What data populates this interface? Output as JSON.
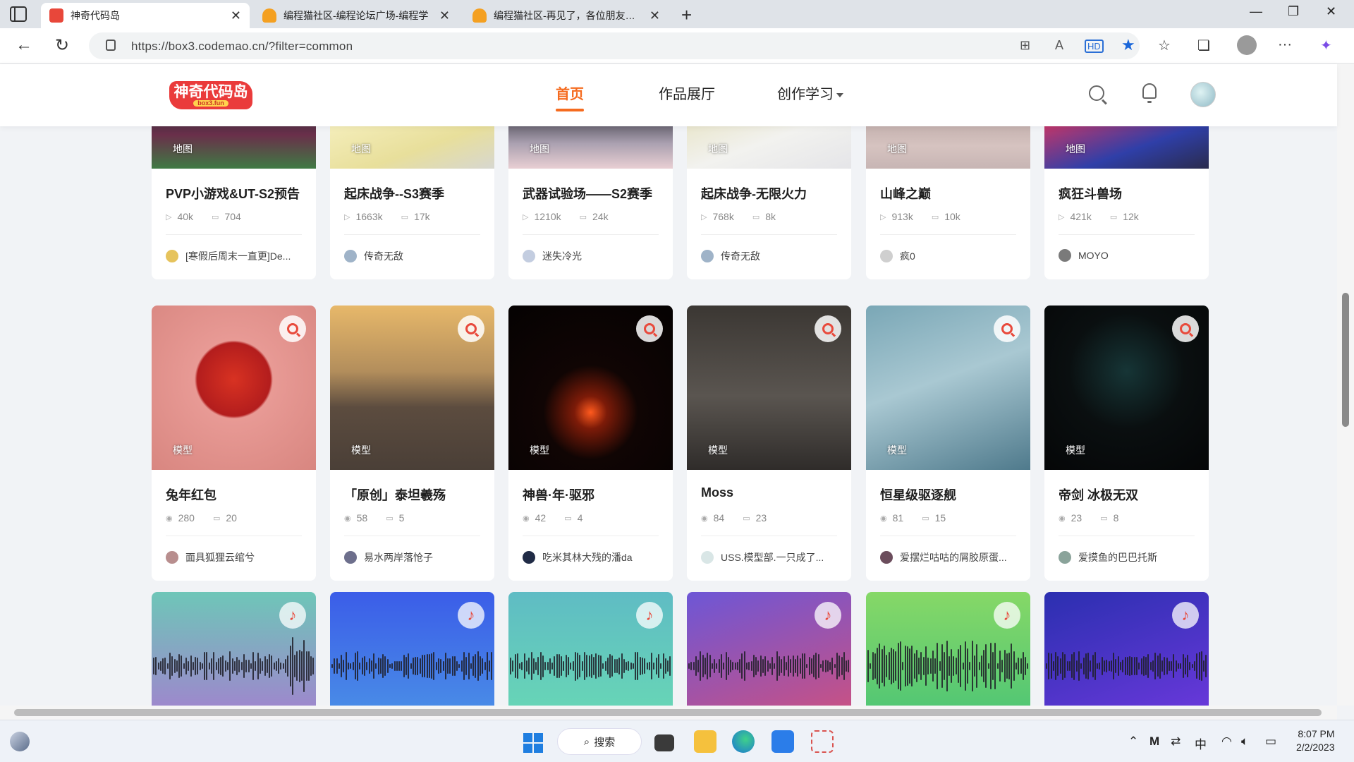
{
  "browser": {
    "tabs": [
      {
        "title": "神奇代码岛",
        "active": true
      },
      {
        "title": "编程猫社区-编程论坛广场-编程学",
        "active": false
      },
      {
        "title": "编程猫社区-再见了，各位朋友，再",
        "active": false
      }
    ],
    "url": "https://box3.codemao.cn/?filter=common"
  },
  "site": {
    "logo_text": "神奇代码岛",
    "logo_sub": "box3.fun",
    "nav": [
      "首页",
      "作品展厅",
      "创作学习"
    ]
  },
  "cards": [
    {
      "title": "PVP小游戏&UT-S2预告",
      "tag": "地图",
      "plays": "40k",
      "comments": "704",
      "author": "[寒假后周末一直更]De..."
    },
    {
      "title": "起床战争--S3赛季",
      "tag": "地图",
      "plays": "1663k",
      "comments": "17k",
      "author": "传奇无敌"
    },
    {
      "title": "武器试验场——S2赛季",
      "tag": "地图",
      "plays": "1210k",
      "comments": "24k",
      "author": "迷失冷光"
    },
    {
      "title": "起床战争-无限火力",
      "tag": "地图",
      "plays": "768k",
      "comments": "8k",
      "author": "传奇无敌"
    },
    {
      "title": "山峰之巅",
      "tag": "地图",
      "plays": "913k",
      "comments": "10k",
      "author": "疯0"
    },
    {
      "title": "疯狂斗兽场",
      "tag": "地图",
      "plays": "421k",
      "comments": "12k",
      "author": "MOYO"
    },
    {
      "title": "兔年红包",
      "tag": "模型",
      "plays": "280",
      "comments": "20",
      "author": "面具狐狸云绾兮"
    },
    {
      "title": "「原创」泰坦羲殇",
      "tag": "模型",
      "plays": "58",
      "comments": "5",
      "author": "易水两岸落怆子"
    },
    {
      "title": "神兽·年·驱邪",
      "tag": "模型",
      "plays": "42",
      "comments": "4",
      "author": "吃米其林大残的潘da"
    },
    {
      "title": "Moss",
      "tag": "模型",
      "plays": "84",
      "comments": "23",
      "author": "USS.模型部.一只成了..."
    },
    {
      "title": "恒星级驱逐舰",
      "tag": "模型",
      "plays": "81",
      "comments": "15",
      "author": "爱摆烂咕咕的屑胶原蛋..."
    },
    {
      "title": "帝剑 冰极无双",
      "tag": "模型",
      "plays": "23",
      "comments": "8",
      "author": "爱摸鱼的巴巴托斯"
    }
  ],
  "taskbar": {
    "search_label": "搜索",
    "ime": "中",
    "time": "8:07 PM",
    "date": "2/2/2023"
  },
  "colors": {
    "accent": "#f56b1f",
    "icon_red": "#e84a3c"
  }
}
